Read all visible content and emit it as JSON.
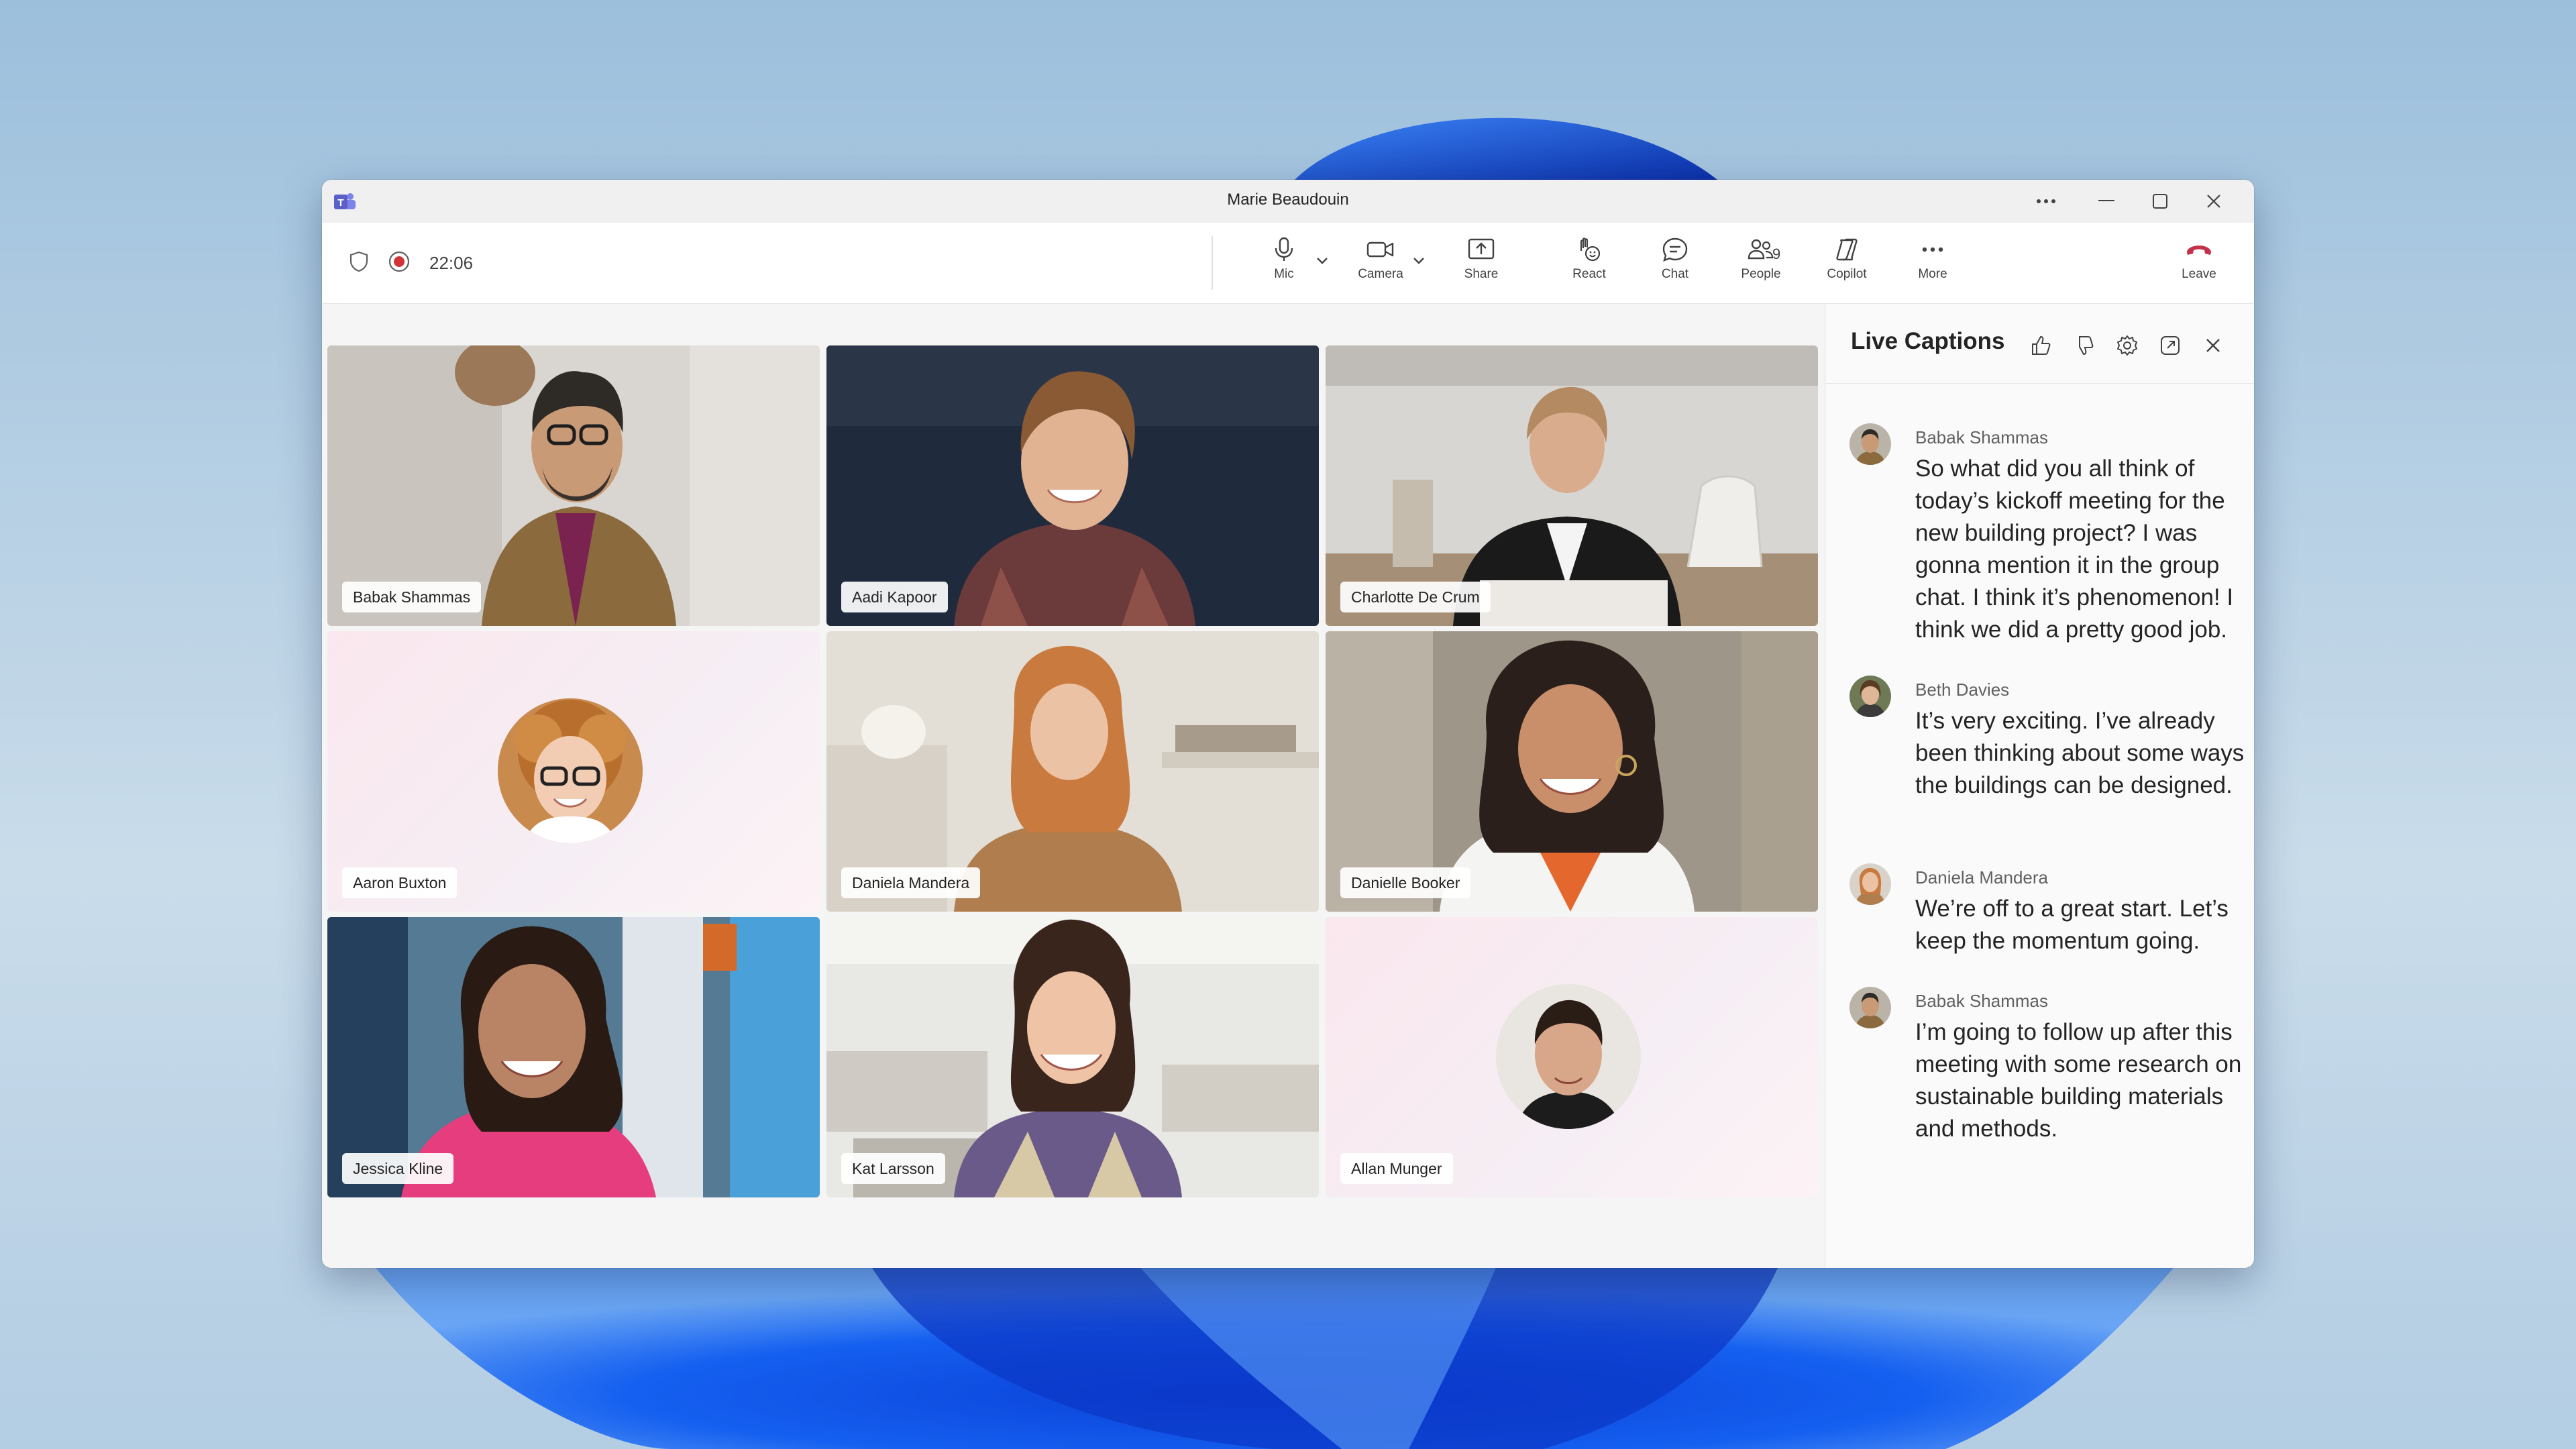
{
  "window": {
    "title": "Marie Beaudouin"
  },
  "toolbar": {
    "timer": "22:06",
    "buttons": {
      "mic": "Mic",
      "camera": "Camera",
      "share": "Share",
      "react": "React",
      "chat": "Chat",
      "people": "People",
      "people_count": "9",
      "copilot": "Copilot",
      "more": "More",
      "leave": "Leave"
    }
  },
  "participants": [
    "Babak Shammas",
    "Aadi Kapoor",
    "Charlotte De Crum",
    "Aaron Buxton",
    "Daniela Mandera",
    "Danielle Booker",
    "Jessica Kline",
    "Kat Larsson",
    "Allan Munger"
  ],
  "captions_panel": {
    "title": "Live Captions",
    "entries": [
      {
        "speaker": "Babak Shammas",
        "text": "So what did you all think of today’s kickoff meeting for the new building project? I was gonna mention it in the group chat. I think it’s phenomenon! I think we did a pretty good job."
      },
      {
        "speaker": "Beth Davies",
        "text": "It’s very exciting. I’ve already been thinking about some ways the buildings can be designed."
      },
      {
        "speaker": "Daniela Mandera",
        "text": "We’re off to a great start. Let’s keep the momentum going."
      },
      {
        "speaker": "Babak Shammas",
        "text": "I’m going to follow up after this meeting with some research on sustainable building materials and methods."
      }
    ]
  },
  "colors": {
    "accent": "#5b5fc7",
    "leave": "#c4314b",
    "record": "#d13438"
  },
  "icons": [
    "teams-logo-icon",
    "shield-icon",
    "record-icon",
    "mic-icon",
    "camera-icon",
    "share-icon",
    "react-icon",
    "chat-icon",
    "people-icon",
    "copilot-icon",
    "more-icon",
    "leave-icon",
    "thumbs-up-icon",
    "thumbs-down-icon",
    "gear-icon",
    "popout-icon",
    "close-icon"
  ]
}
